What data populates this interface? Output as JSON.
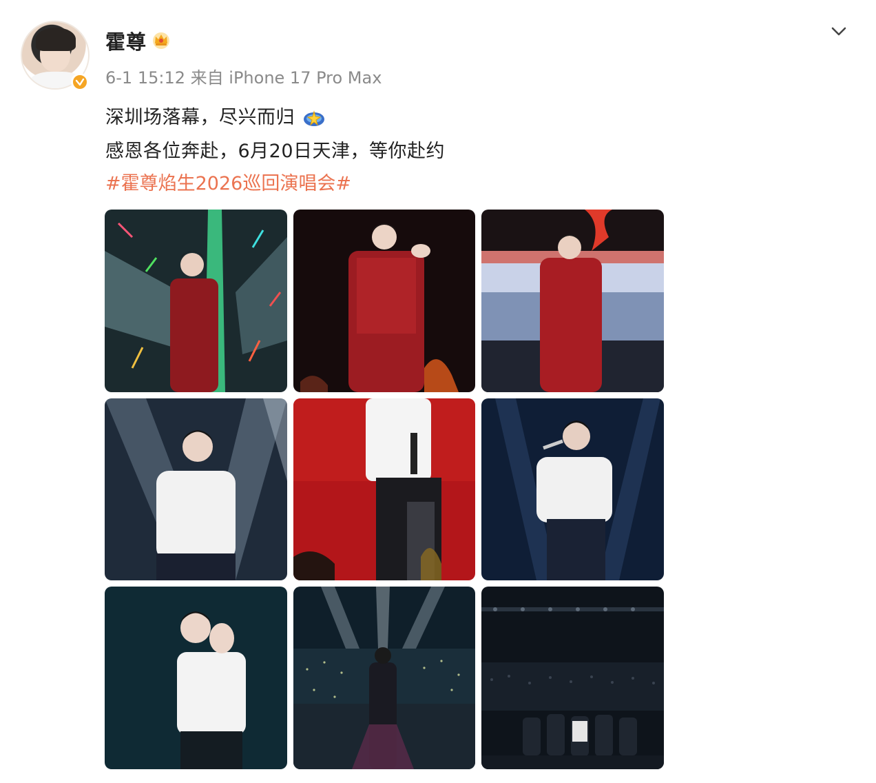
{
  "post": {
    "username": "霍尊",
    "timestamp": "6-1 15:12",
    "source_prefix": "来自",
    "device": "iPhone 17 Pro Max",
    "text_line1": "深圳场落幕，尽兴而归",
    "text_line2": "感恩各位奔赴，6月20日天津，等你赴约",
    "hashtag": "#霍尊焰生2026巡回演唱会#",
    "badges": {
      "verified": "verified-badge-icon",
      "member": "crown-icon"
    },
    "colors": {
      "hashtag": "#eb7350",
      "meta": "#8a8a8a",
      "verified": "#f5a524"
    }
  },
  "photos": [
    {
      "label": "concert-photo-1",
      "theme": "red outfit with green light beams"
    },
    {
      "label": "concert-photo-2",
      "theme": "red outfit dark stage"
    },
    {
      "label": "concert-photo-3",
      "theme": "red outfit in front of screen"
    },
    {
      "label": "concert-photo-4",
      "theme": "white shirt spotlight"
    },
    {
      "label": "concert-photo-5",
      "theme": "white shirt red backdrop"
    },
    {
      "label": "concert-photo-6",
      "theme": "white shirt blue stage"
    },
    {
      "label": "concert-photo-7",
      "theme": "white shirt close up"
    },
    {
      "label": "concert-photo-8",
      "theme": "stage facing audience"
    },
    {
      "label": "concert-photo-9",
      "theme": "group bow with audience"
    }
  ]
}
